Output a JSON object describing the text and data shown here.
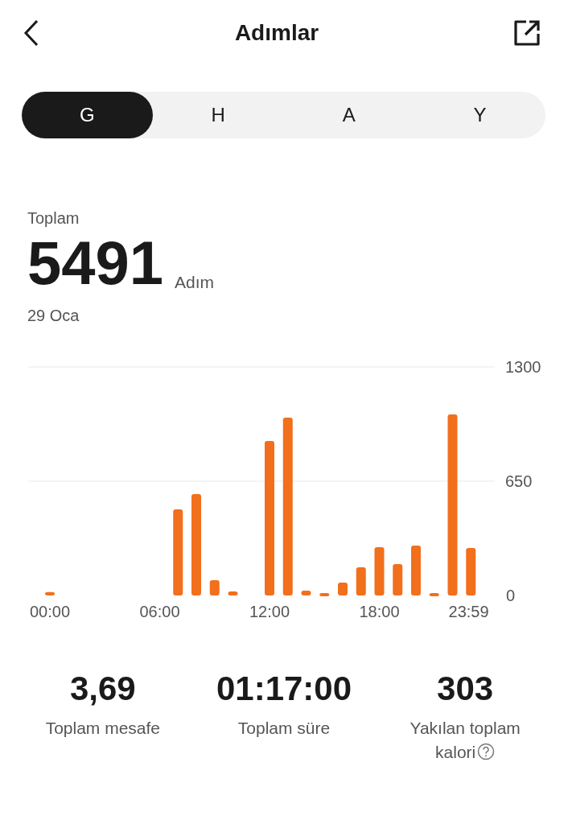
{
  "header": {
    "title": "Adımlar"
  },
  "tabs": [
    {
      "label": "G",
      "selected": true
    },
    {
      "label": "H",
      "selected": false
    },
    {
      "label": "A",
      "selected": false
    },
    {
      "label": "Y",
      "selected": false
    }
  ],
  "summary": {
    "label": "Toplam",
    "value": "5491",
    "unit": "Adım",
    "date": "29 Oca"
  },
  "chart_data": {
    "type": "bar",
    "x": [
      0,
      420,
      480,
      540,
      600,
      720,
      780,
      840,
      900,
      960,
      1020,
      1080,
      1140,
      1200,
      1260,
      1320,
      1380
    ],
    "xlim": [
      0,
      1439
    ],
    "series": [
      {
        "color": "#f26f1c",
        "values": [
          20,
          490,
          577,
          87,
          23,
          879,
          1012,
          27,
          14,
          73,
          160,
          275,
          179,
          284,
          14,
          1030,
          270
        ]
      }
    ],
    "ylim": [
      0,
      1300
    ],
    "yticks": [
      0,
      650,
      1300
    ],
    "xticks": [
      {
        "value": 0,
        "label": "00:00"
      },
      {
        "value": 360,
        "label": "06:00"
      },
      {
        "value": 720,
        "label": "12:00"
      },
      {
        "value": 1080,
        "label": "18:00"
      },
      {
        "value": 1439,
        "label": "23:59"
      }
    ]
  },
  "stats": [
    {
      "value": "3,69",
      "label": "Toplam mesafe",
      "info": false
    },
    {
      "value": "01:17:00",
      "label": "Toplam süre",
      "info": false
    },
    {
      "value": "303",
      "label": "Yakılan toplam kalori",
      "info": true
    }
  ]
}
